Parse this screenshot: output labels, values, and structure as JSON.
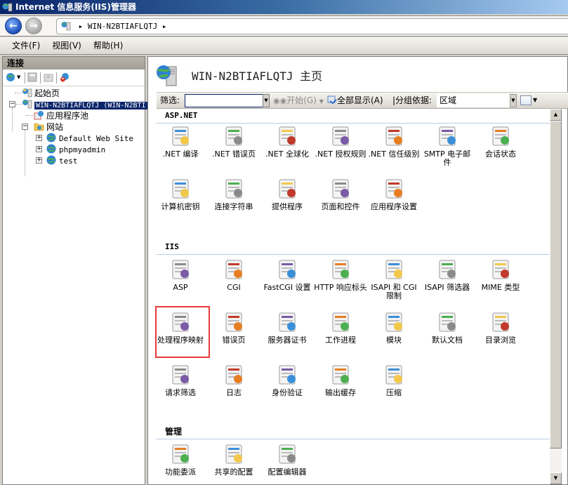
{
  "window": {
    "title": "Internet 信息服务(IIS)管理器"
  },
  "nav": {
    "back_icon": "back-arrow-icon",
    "forward_icon": "forward-arrow-icon",
    "breadcrumb": [
      "WIN-N2BTIAFLQTJ"
    ],
    "separator": "▸"
  },
  "menu": [
    {
      "label": "文件(F)"
    },
    {
      "label": "视图(V)"
    },
    {
      "label": "帮助(H)"
    }
  ],
  "connections": {
    "title": "连接",
    "toolbar": [
      "connect-icon",
      "save-icon",
      "up-icon",
      "disconnect-icon"
    ],
    "tree": [
      {
        "label": "起始页",
        "icon": "start-page-icon",
        "level": 0
      },
      {
        "label": "WIN-N2BTIAFLQTJ (WIN-N2BTI",
        "icon": "server-icon",
        "level": 0,
        "selected": true,
        "expanded": true
      },
      {
        "label": "应用程序池",
        "icon": "app-pool-icon",
        "level": 1
      },
      {
        "label": "网站",
        "icon": "sites-folder-icon",
        "level": 1,
        "expanded": true
      },
      {
        "label": "Default Web Site",
        "icon": "globe-icon",
        "level": 2,
        "collapsed": true
      },
      {
        "label": "phpmyadmin",
        "icon": "globe-icon",
        "level": 2,
        "collapsed": true
      },
      {
        "label": "test",
        "icon": "globe-icon",
        "level": 2,
        "collapsed": true
      }
    ]
  },
  "page": {
    "title": "WIN-N2BTIAFLQTJ 主页",
    "filter": {
      "label": "筛选:",
      "value": "",
      "start_label": "开始(G)",
      "show_all_label": "全部显示(A)",
      "group_by_label": "|分组依据:",
      "group_by_value": "区域"
    },
    "sections": [
      {
        "title": "ASP.NET",
        "features": [
          {
            "label": ".NET 编译",
            "icon": "net-compile-icon"
          },
          {
            "label": ".NET 错误页",
            "icon": "error-404-icon"
          },
          {
            "label": ".NET 全球化",
            "icon": "globe-stand-icon"
          },
          {
            "label": ".NET 授权规则",
            "icon": "auth-rules-icon"
          },
          {
            "label": ".NET 信任级别",
            "icon": "trust-level-icon"
          },
          {
            "label": "SMTP 电子邮件",
            "icon": "smtp-email-icon"
          },
          {
            "label": "会话状态",
            "icon": "session-state-icon"
          },
          {
            "label": "计算机密钥",
            "icon": "machine-key-icon"
          },
          {
            "label": "连接字符串",
            "icon": "connection-string-icon"
          },
          {
            "label": "提供程序",
            "icon": "providers-icon"
          },
          {
            "label": "页面和控件",
            "icon": "pages-controls-icon"
          },
          {
            "label": "应用程序设置",
            "icon": "app-settings-icon"
          }
        ]
      },
      {
        "title": "IIS",
        "features": [
          {
            "label": "ASP",
            "icon": "asp-icon"
          },
          {
            "label": "CGI",
            "icon": "cgi-icon"
          },
          {
            "label": "FastCGI 设置",
            "icon": "fastcgi-icon"
          },
          {
            "label": "HTTP 响应标头",
            "icon": "http-headers-icon"
          },
          {
            "label": "ISAPI 和 CGI 限制",
            "icon": "isapi-cgi-restrictions-icon"
          },
          {
            "label": "ISAPI 筛选器",
            "icon": "isapi-filter-icon"
          },
          {
            "label": "MIME 类型",
            "icon": "mime-types-icon"
          },
          {
            "label": "处理程序映射",
            "icon": "handler-mappings-icon",
            "highlighted": true
          },
          {
            "label": "错误页",
            "icon": "error-404-icon"
          },
          {
            "label": "服务器证书",
            "icon": "certificates-icon"
          },
          {
            "label": "工作进程",
            "icon": "worker-process-icon"
          },
          {
            "label": "模块",
            "icon": "modules-icon"
          },
          {
            "label": "默认文档",
            "icon": "default-document-icon"
          },
          {
            "label": "目录浏览",
            "icon": "directory-browsing-icon"
          },
          {
            "label": "请求筛选",
            "icon": "request-filtering-icon"
          },
          {
            "label": "日志",
            "icon": "logging-icon"
          },
          {
            "label": "身份验证",
            "icon": "authentication-icon"
          },
          {
            "label": "输出缓存",
            "icon": "output-cache-icon"
          },
          {
            "label": "压缩",
            "icon": "compression-icon"
          }
        ]
      },
      {
        "title": "管理",
        "features": [
          {
            "label": "功能委派",
            "icon": "feature-delegation-icon"
          },
          {
            "label": "共享的配置",
            "icon": "shared-config-icon"
          },
          {
            "label": "配置编辑器",
            "icon": "config-editor-icon"
          }
        ]
      }
    ]
  },
  "colors": {
    "selection": "#0a246a",
    "highlight_box": "#e53a3a",
    "section_rule": "#b8cde6"
  }
}
